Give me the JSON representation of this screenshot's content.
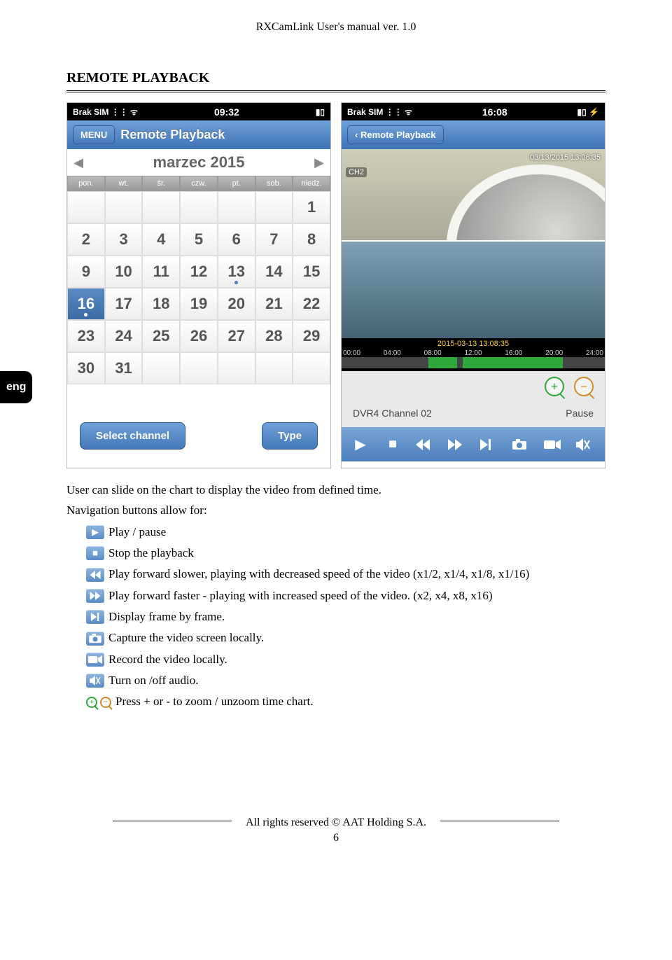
{
  "header": {
    "title": "RXCamLink User's manual ver. 1.0"
  },
  "section": {
    "title": "REMOTE PLAYBACK"
  },
  "lang_tab": "eng",
  "phone1": {
    "status": {
      "carrier": "Brak SIM",
      "time": "09:32"
    },
    "nav": {
      "menu_label": "MENU",
      "title": "Remote Playback"
    },
    "calendar": {
      "month_label": "marzec 2015",
      "weekdays": [
        "pon.",
        "wt.",
        "śr.",
        "czw.",
        "pt.",
        "sob.",
        "niedz."
      ],
      "days": [
        [
          "",
          "",
          "",
          "",
          "",
          "",
          "1"
        ],
        [
          "2",
          "3",
          "4",
          "5",
          "6",
          "7",
          "8"
        ],
        [
          "9",
          "10",
          "11",
          "12",
          "13",
          "14",
          "15"
        ],
        [
          "16",
          "17",
          "18",
          "19",
          "20",
          "21",
          "22"
        ],
        [
          "23",
          "24",
          "25",
          "26",
          "27",
          "28",
          "29"
        ],
        [
          "30",
          "31",
          "",
          "",
          "",
          "",
          ""
        ]
      ],
      "selected": "16",
      "dots": [
        "13",
        "16"
      ]
    },
    "buttons": {
      "select_channel": "Select channel",
      "type": "Type"
    }
  },
  "phone2": {
    "status": {
      "carrier": "Brak SIM",
      "time": "16:08"
    },
    "nav": {
      "back_label": "Remote Playback"
    },
    "video": {
      "timestamp": "03/13/2015 13:08:35",
      "channel_tag": "CH2"
    },
    "timeline": {
      "center_label": "2015-03-13 13:08:35",
      "ticks": [
        "00:00",
        "04:00",
        "08:00",
        "12:00",
        "16:00",
        "20:00",
        "24:00"
      ]
    },
    "info": {
      "device": "DVR4  Channel 02",
      "state": "Pause"
    }
  },
  "desc": {
    "p1": "User can slide on the chart to display the video from defined time.",
    "p2": "Navigation buttons allow for:",
    "items": {
      "play": "Play / pause",
      "stop": "Stop the playback",
      "slower": "Play forward slower, playing with decreased speed of the video (x1/2, x1/4, x1/8, x1/16)",
      "faster": "Play forward faster - playing with increased speed of the video. (x2, x4, x8, x16)",
      "frame": "Display frame by frame.",
      "capture": "Capture the video screen locally.",
      "record": "Record the video locally.",
      "audio": "Turn on /off audio.",
      "zoom": "Press + or - to zoom / unzoom time chart."
    }
  },
  "footer": {
    "text": "All rights reserved © AAT Holding S.A.",
    "page": "6"
  }
}
